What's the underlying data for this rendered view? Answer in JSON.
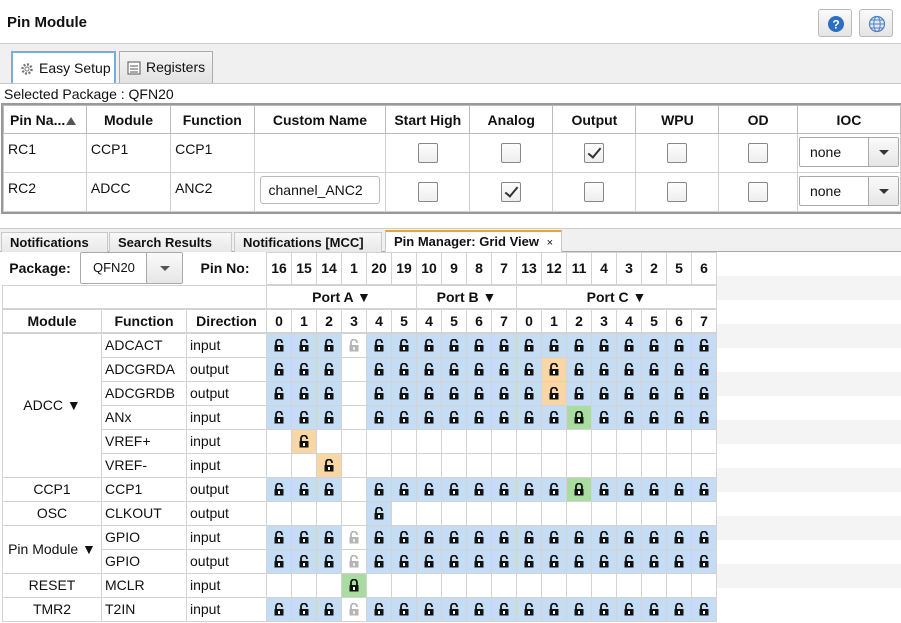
{
  "title": "Pin Module",
  "tabs": {
    "easy": "Easy Setup",
    "registers": "Registers"
  },
  "selected_package": "Selected Package : QFN20",
  "pin_table": {
    "headers": [
      "Pin Na...",
      "Module",
      "Function",
      "Custom Name",
      "Start High",
      "Analog",
      "Output",
      "WPU",
      "OD",
      "IOC"
    ],
    "rows": [
      {
        "pin": "RC1",
        "module": "CCP1",
        "function": "CCP1",
        "custom": "",
        "start_high": false,
        "analog": false,
        "output": true,
        "wpu": false,
        "od": false,
        "ioc": "none"
      },
      {
        "pin": "RC2",
        "module": "ADCC",
        "function": "ANC2",
        "custom": "channel_ANC2",
        "start_high": false,
        "analog": true,
        "output": false,
        "wpu": false,
        "od": false,
        "ioc": "none"
      }
    ]
  },
  "bottom_tabs": [
    "Notifications",
    "Search Results",
    "Notifications [MCC]",
    "Pin Manager: Grid View"
  ],
  "close_glyph": "×",
  "grid": {
    "package_label": "Package:",
    "package_value": "QFN20",
    "pin_no_label": "Pin No:",
    "pins": [
      "16",
      "15",
      "14",
      "1",
      "20",
      "19",
      "10",
      "9",
      "8",
      "7",
      "13",
      "12",
      "11",
      "4",
      "3",
      "2",
      "5",
      "6"
    ],
    "ports": [
      "Port A ▼",
      "Port B ▼",
      "Port C ▼"
    ],
    "bits": [
      "0",
      "1",
      "2",
      "3",
      "4",
      "5",
      "4",
      "5",
      "6",
      "7",
      "0",
      "1",
      "2",
      "3",
      "4",
      "5",
      "6",
      "7"
    ],
    "col_headers": [
      "Module",
      "Function",
      "Direction"
    ],
    "modules": [
      {
        "name": "ADCC ▼",
        "rows": 6
      },
      {
        "name": "CCP1",
        "rows": 1
      },
      {
        "name": "OSC",
        "rows": 1
      },
      {
        "name": "Pin Module ▼",
        "rows": 2
      },
      {
        "name": "RESET",
        "rows": 1
      },
      {
        "name": "TMR2",
        "rows": 1
      }
    ],
    "rows": [
      {
        "function": "ADCACT",
        "direction": "input",
        "cells": "BBBGBBBBBBBBBBBBBB",
        "lock": "LLLULLLLLLLLLLLLLL"
      },
      {
        "function": "ADCGRDA",
        "direction": "output",
        "cells": "BBB.BBBBBBBOBBBBBB",
        "lock": "LLL.LLLLLLLLLLLLLL"
      },
      {
        "function": "ADCGRDB",
        "direction": "output",
        "cells": "BBB.BBBBBBBOBBBBBB",
        "lock": "LLL.LLLLLLLLLLLLLL"
      },
      {
        "function": "ANx",
        "direction": "input",
        "cells": "BBB.BBBBBBBBgBBBBB",
        "lock": "LLL.LLLLLLLLCLLLLL"
      },
      {
        "function": "VREF+",
        "direction": "input",
        "cells": ".O................",
        "lock": ".L................"
      },
      {
        "function": "VREF-",
        "direction": "input",
        "cells": "..O...............",
        "lock": "..L..............."
      },
      {
        "function": "CCP1",
        "direction": "output",
        "cells": "BBB.BBBBBBBBgBBBBB",
        "lock": "LLL.LLLLLLLLCLLLLL"
      },
      {
        "function": "CLKOUT",
        "direction": "output",
        "cells": "....B.............",
        "lock": "....L............."
      },
      {
        "function": "GPIO",
        "direction": "input",
        "cells": "BBBGBBBBBBBBBBBBBB",
        "lock": "LLLULLLLLLLLLLLLLL"
      },
      {
        "function": "GPIO",
        "direction": "output",
        "cells": "BBBGBBBBBBBBBBBBBB",
        "lock": "LLLULLLLLLLLLLLLLL"
      },
      {
        "function": "MCLR",
        "direction": "input",
        "cells": "...g..............",
        "lock": "...C.............."
      },
      {
        "function": "T2IN",
        "direction": "input",
        "cells": "BBBGBBBBBBBBBBBBBB",
        "lock": "LLLULLLLLLLLLLLLLL"
      }
    ]
  },
  "icons": [
    "help-icon",
    "globe-icon",
    "gear-icon",
    "registers-icon",
    "sort-up-icon",
    "lock-icon",
    "unlock-icon"
  ]
}
